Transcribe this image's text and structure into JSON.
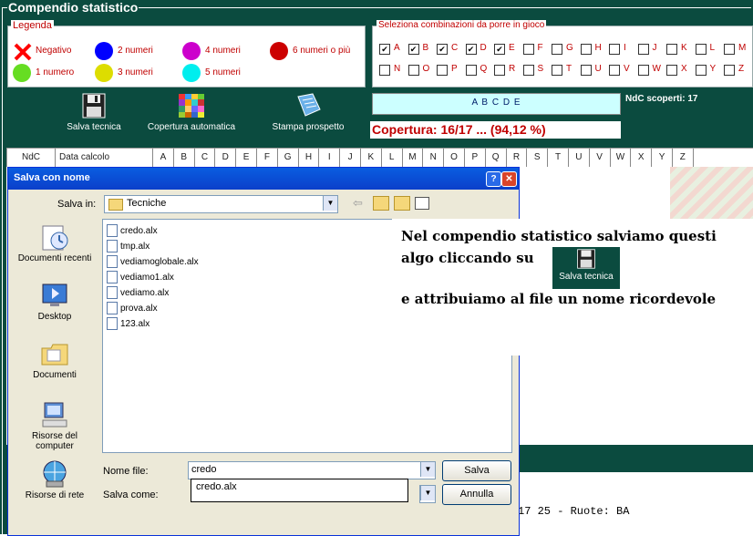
{
  "app": {
    "title": "Compendio statistico",
    "legend": {
      "title": "Legenda",
      "items": [
        {
          "label": "Negativo",
          "color": "#ff0000",
          "shape": "x"
        },
        {
          "label": "2 numeri",
          "color": "#0000ff"
        },
        {
          "label": "4 numeri",
          "color": "#cc00cc"
        },
        {
          "label": "6 numeri o più",
          "color": "#cc0000"
        },
        {
          "label": "1 numero",
          "color": "#66dd22"
        },
        {
          "label": "3 numeri",
          "color": "#dddd00"
        },
        {
          "label": "5 numeri",
          "color": "#00eeee"
        }
      ]
    },
    "selection": {
      "title": "Seleziona combinazioni da porre in gioco",
      "row1": [
        {
          "l": "A",
          "c": true
        },
        {
          "l": "B",
          "c": true
        },
        {
          "l": "C",
          "c": true
        },
        {
          "l": "D",
          "c": true
        },
        {
          "l": "E",
          "c": true
        },
        {
          "l": "F",
          "c": false
        },
        {
          "l": "G",
          "c": false
        },
        {
          "l": "H",
          "c": false
        },
        {
          "l": "I",
          "c": false
        },
        {
          "l": "J",
          "c": false
        },
        {
          "l": "K",
          "c": false
        },
        {
          "l": "L",
          "c": false
        },
        {
          "l": "M",
          "c": false
        }
      ],
      "row2": [
        {
          "l": "N",
          "c": false
        },
        {
          "l": "O",
          "c": false
        },
        {
          "l": "P",
          "c": false
        },
        {
          "l": "Q",
          "c": false
        },
        {
          "l": "R",
          "c": false
        },
        {
          "l": "S",
          "c": false
        },
        {
          "l": "T",
          "c": false
        },
        {
          "l": "U",
          "c": false
        },
        {
          "l": "V",
          "c": false
        },
        {
          "l": "W",
          "c": false
        },
        {
          "l": "X",
          "c": false
        },
        {
          "l": "Y",
          "c": false
        },
        {
          "l": "Z",
          "c": false
        }
      ]
    },
    "toolbar": {
      "salva": "Salva tecnica",
      "copertura": "Copertura automatica",
      "stampa": "Stampa prospetto"
    },
    "combo_display": "A B C D E",
    "ndc_scoperti": "NdC scoperti: 17",
    "copertura_text": "Copertura: 16/17 ... (94,12 %)",
    "grid_headers": {
      "ndc": "NdC",
      "data": "Data calcolo",
      "letters": [
        "A",
        "B",
        "C",
        "D",
        "E",
        "F",
        "G",
        "H",
        "I",
        "J",
        "K",
        "L",
        "M",
        "N",
        "O",
        "P",
        "Q",
        "R",
        "S",
        "T",
        "U",
        "V",
        "W",
        "X",
        "Y",
        "Z"
      ]
    },
    "bottom_text": "17 25 - Ruote: BA"
  },
  "dialog": {
    "title": "Salva con nome",
    "help": "?",
    "close": "✕",
    "save_in_label": "Salva in:",
    "save_in_value": "Tecniche",
    "places": [
      "Documenti recenti",
      "Desktop",
      "Documenti",
      "Risorse del computer",
      "Risorse di rete"
    ],
    "files": [
      "credo.alx",
      "tmp.alx",
      "vediamoglobale.alx",
      "vediamo1.alx",
      "vediamo.alx",
      "prova.alx",
      "123.alx"
    ],
    "filename_label": "Nome file:",
    "filename_value": "credo",
    "filetype_label": "Salva come:",
    "autocomplete": "credo.alx",
    "save_button": "Salva",
    "cancel_button": "Annulla"
  },
  "caption": {
    "line1": "Nel compendio statistico salviamo questi",
    "line2": "algo cliccando su",
    "icon_label": "Salva tecnica",
    "line3": "e attribuiamo al file un nome ricordevole"
  }
}
